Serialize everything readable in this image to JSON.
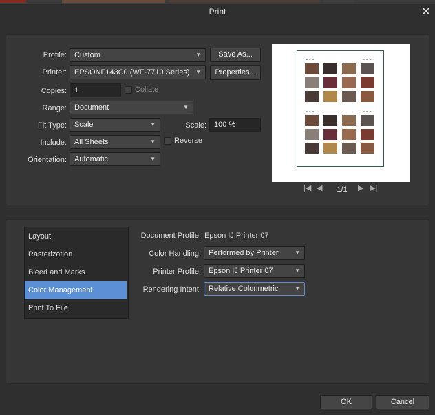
{
  "window": {
    "title": "Print"
  },
  "setup": {
    "profile_label": "Profile:",
    "profile_value": "Custom",
    "save_as_label": "Save As...",
    "printer_label": "Printer:",
    "printer_value": "EPSONF143C0 (WF-7710 Series)",
    "properties_label": "Properties...",
    "copies_label": "Copies:",
    "copies_value": "1",
    "collate_label": "Collate",
    "range_label": "Range:",
    "range_value": "Document",
    "fit_type_label": "Fit Type:",
    "fit_type_value": "Scale",
    "scale_label": "Scale:",
    "scale_value": "100 %",
    "include_label": "Include:",
    "include_value": "All Sheets",
    "reverse_label": "Reverse",
    "orientation_label": "Orientation:",
    "orientation_value": "Automatic"
  },
  "preview": {
    "page_indicator": "1/1"
  },
  "categories": [
    {
      "label": "Layout",
      "selected": false
    },
    {
      "label": "Rasterization",
      "selected": false
    },
    {
      "label": "Bleed and Marks",
      "selected": false
    },
    {
      "label": "Color Management",
      "selected": true
    },
    {
      "label": "Print To File",
      "selected": false
    }
  ],
  "color_management": {
    "doc_profile_label": "Document Profile:",
    "doc_profile_value": "Epson IJ Printer 07",
    "color_handling_label": "Color Handling:",
    "color_handling_value": "Performed by Printer",
    "printer_profile_label": "Printer Profile:",
    "printer_profile_value": "Epson IJ Printer 07",
    "rendering_intent_label": "Rendering Intent:",
    "rendering_intent_value": "Relative Colorimetric"
  },
  "footer": {
    "ok_label": "OK",
    "cancel_label": "Cancel"
  },
  "colors": {
    "accent": "#5b8fd6",
    "background": "#2f2f2f",
    "panel": "#363636"
  }
}
